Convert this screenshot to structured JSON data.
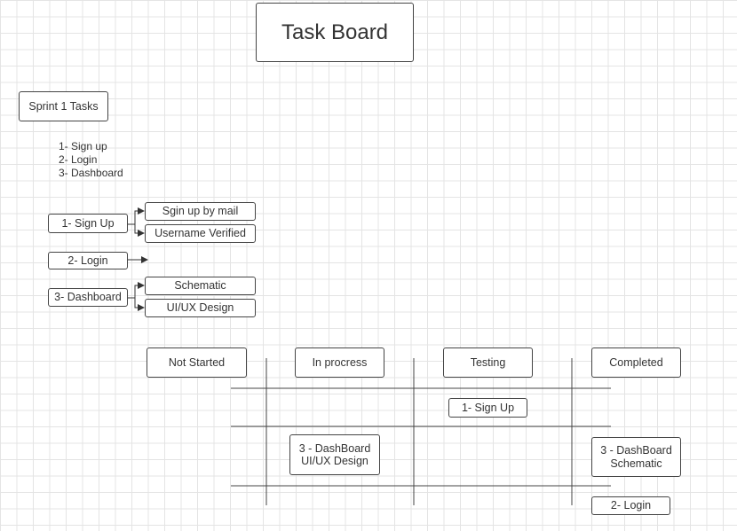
{
  "title": "Task Board",
  "sprint_label": "Sprint 1 Tasks",
  "task_list": [
    "1- Sign up",
    "2- Login",
    "3- Dashboard"
  ],
  "breakdown": {
    "signup": {
      "label": "1- Sign Up",
      "subtasks": [
        "Sgin up by mail",
        "Username Verified"
      ]
    },
    "login": {
      "label": "2- Login"
    },
    "dashboard": {
      "label": "3- Dashboard",
      "subtasks": [
        "Schematic",
        "UI/UX Design"
      ]
    }
  },
  "columns": [
    "Not Started",
    "In procress",
    "Testing",
    "Completed"
  ],
  "cards": {
    "testing_signup": "1- Sign Up",
    "inprocess_dashboard": [
      "3 - DashBoard",
      "UI/UX Design"
    ],
    "completed_dashboard": [
      "3 - DashBoard",
      "Schematic"
    ],
    "completed_login": "2- Login"
  }
}
